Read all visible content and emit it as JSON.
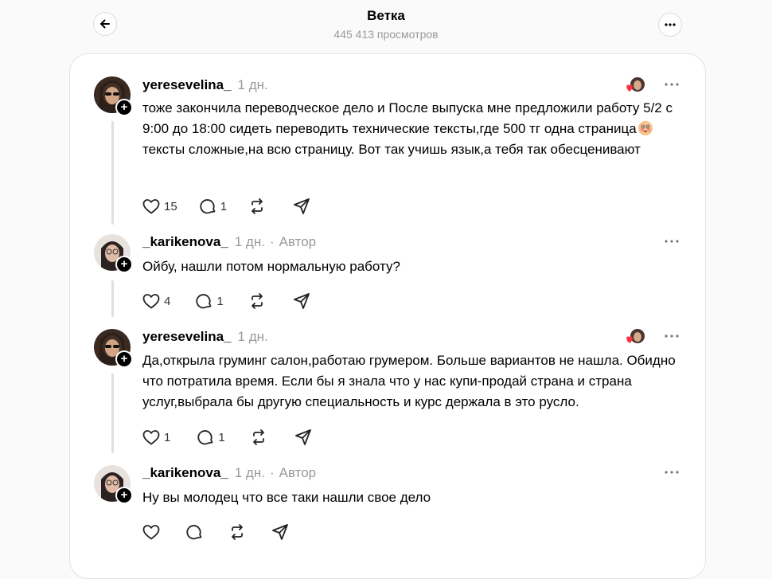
{
  "header": {
    "title": "Ветка",
    "views": "445 413 просмотров"
  },
  "posts": [
    {
      "username": "yeresevelina_",
      "time": "1 дн.",
      "author_tag": "",
      "text_before": "тоже закончила переводческое дело и После выпуска мне предложили работу 5/2 с 9:00 до 18:00 сидеть переводить технические тексты,где 500 тг одна страница",
      "emoji": "flushed-face",
      "text_after": " тексты сложные,на всю страницу. Вот так учишь язык,а тебя так обесценивают",
      "likes": "15",
      "replies": "1",
      "liked_by_author": true
    },
    {
      "username": "_karikenova_",
      "time": "1 дн.",
      "author_tag": "Автор",
      "text": "Ойбу, нашли потом нормальную работу?",
      "likes": "4",
      "replies": "1"
    },
    {
      "username": "yeresevelina_",
      "time": "1 дн.",
      "author_tag": "",
      "text": "Да,открыла груминг салон,работаю грумером. Больше вариантов не нашла. Обидно что потратила время. Если бы я знала что у нас купи-продай страна и страна услуг,выбрала бы другую специальность и курс держала в это русло.",
      "likes": "1",
      "replies": "1",
      "liked_by_author": true
    },
    {
      "username": "_karikenova_",
      "time": "1 дн.",
      "author_tag": "Автор",
      "text": "Ну вы молодец что все таки нашли свое дело",
      "likes": "",
      "replies": ""
    }
  ],
  "colors": {
    "like_heart": "#ff3040",
    "muted": "#999999",
    "text": "#000000"
  },
  "icons": [
    "back-arrow-icon",
    "more-icon",
    "heart-icon",
    "comment-icon",
    "repost-icon",
    "share-icon",
    "ellipsis-icon"
  ]
}
